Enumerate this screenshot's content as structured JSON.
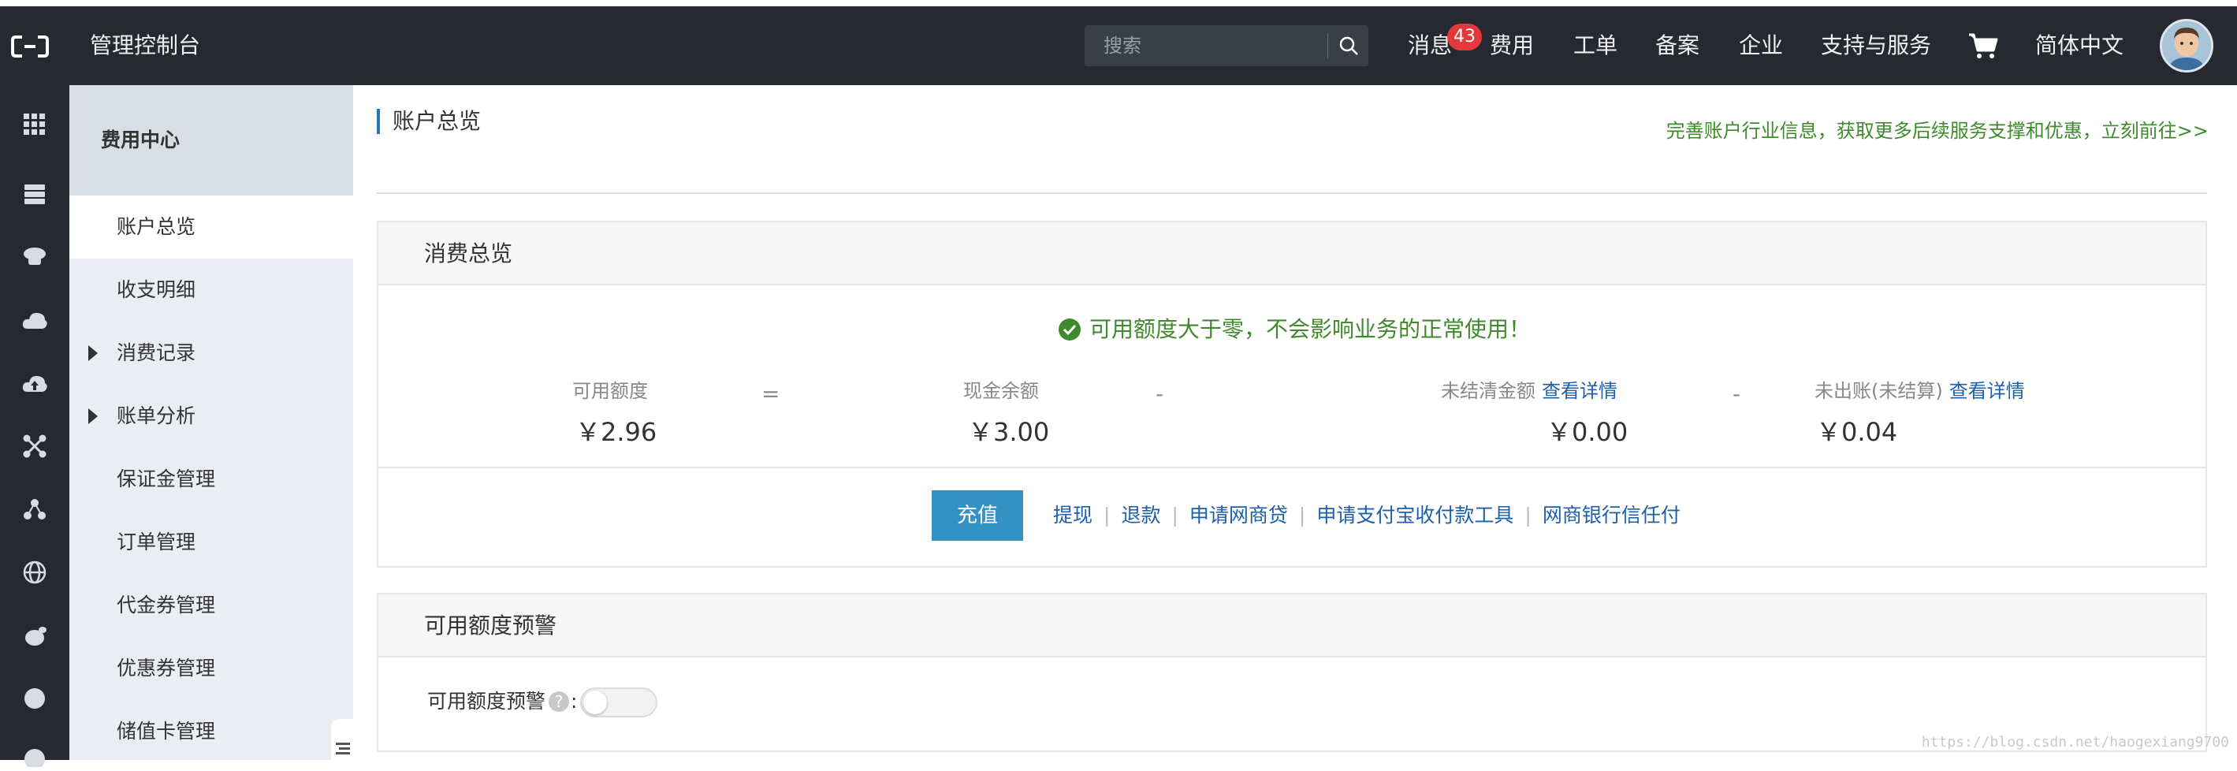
{
  "header": {
    "app_title": "管理控制台",
    "search_placeholder": "搜索",
    "nav": [
      {
        "label": "消息"
      },
      {
        "label": "费用"
      },
      {
        "label": "工单"
      },
      {
        "label": "备案"
      },
      {
        "label": "企业"
      },
      {
        "label": "支持与服务"
      },
      {
        "label": "简体中文"
      }
    ],
    "message_count": "43"
  },
  "icon_rail": [
    "apps-grid-icon",
    "server-icon",
    "cloud-db-icon",
    "cloud-storage-icon",
    "cloud-upload-icon",
    "network-icon",
    "cluster-icon",
    "globe-icon",
    "security-icon",
    "circle-icon"
  ],
  "sidebar": {
    "header": "费用中心",
    "items": [
      {
        "label": "账户总览",
        "active": true,
        "expandable": false
      },
      {
        "label": "收支明细",
        "active": false,
        "expandable": false
      },
      {
        "label": "消费记录",
        "active": false,
        "expandable": true
      },
      {
        "label": "账单分析",
        "active": false,
        "expandable": true
      },
      {
        "label": "保证金管理",
        "active": false,
        "expandable": false
      },
      {
        "label": "订单管理",
        "active": false,
        "expandable": false
      },
      {
        "label": "代金券管理",
        "active": false,
        "expandable": false
      },
      {
        "label": "优惠券管理",
        "active": false,
        "expandable": false
      },
      {
        "label": "储值卡管理",
        "active": false,
        "expandable": false
      }
    ]
  },
  "main": {
    "page_title": "账户总览",
    "promo_link": "完善账户行业信息，获取更多后续服务支撑和优惠，立刻前往>>",
    "overview": {
      "title": "消费总览",
      "status_message": "可用额度大于零，不会影响业务的正常使用！",
      "metrics": [
        {
          "label": "可用额度",
          "value": "￥2.96"
        },
        {
          "label": "现金余额",
          "value": "￥3.00"
        },
        {
          "label": "未结清金额",
          "value": "￥0.00",
          "link": "查看详情"
        },
        {
          "label": "未出账(未结算)",
          "value": "￥0.04",
          "link": "查看详情"
        }
      ],
      "operators": [
        "=",
        "-",
        "-"
      ],
      "recharge_label": "充值",
      "actions": [
        "提现",
        "退款",
        "申请网商贷",
        "申请支付宝收付款工具",
        "网商银行信任付"
      ]
    },
    "alert": {
      "title": "可用额度预警",
      "label": "可用额度预警",
      "help": "?",
      "colon": ":",
      "enabled": false
    }
  },
  "watermark": "https://blog.csdn.net/haogexiang9700",
  "colors": {
    "topbar": "#262a30",
    "accent_blue": "#3592c4",
    "link_blue": "#1d5faa",
    "success_green": "#3e8a2c",
    "badge_red": "#e4393c"
  }
}
